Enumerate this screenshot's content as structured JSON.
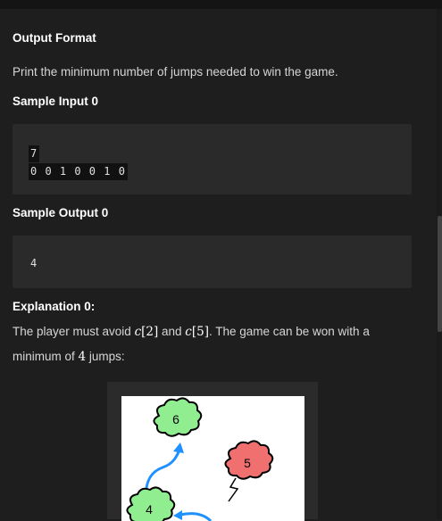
{
  "output_format": {
    "heading": "Output Format",
    "text": "Print the minimum number of jumps needed to win the game."
  },
  "sample_input": {
    "heading": "Sample Input 0",
    "line1": "7",
    "line2": "0 0 1 0 0 1 0"
  },
  "sample_output": {
    "heading": "Sample Output 0",
    "value": "4"
  },
  "explanation": {
    "heading": "Explanation 0:",
    "line1_a": "The player must avoid ",
    "c": "c",
    "idx1": "[2]",
    "and": " and ",
    "idx2": "[5]",
    "line1_b": ". The game can be won with a",
    "line2_a": "minimum of ",
    "jumps": "4",
    "line2_b": " jumps:"
  },
  "figure": {
    "cloud_6": "6",
    "cloud_5": "5",
    "cloud_4": "4",
    "safe_color": "#90ee90",
    "thunder_color": "#f07070",
    "arrow_color": "#1e90ff"
  }
}
